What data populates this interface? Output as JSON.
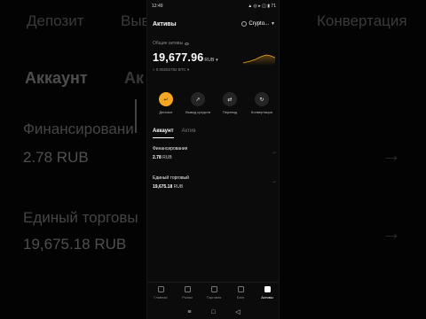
{
  "background": {
    "tabs": [
      "Депозит",
      "Выв",
      "Конвертация"
    ],
    "account_heading": "Аккаунт",
    "assets_heading_partial": "Ак",
    "financing_label": "Финансировани",
    "financing_value": "2.78 RUB",
    "unified_label": "Единый торговы",
    "unified_value": "19,675.18 RUB",
    "arrow": "→"
  },
  "status_bar": {
    "time": "12:49",
    "icons": "▲ ◎ ▸ ◫ ▮ 71"
  },
  "header": {
    "title": "Активы",
    "selector_label": "Crypto...",
    "selector_chevron": "▼"
  },
  "overview": {
    "label": "Общие активы",
    "total_value": "19,677.96",
    "total_currency": "RUB ▾",
    "btc_equiv": "≈ 0.00202792 BTC ▾"
  },
  "actions": [
    {
      "label": "Депозит",
      "icon": "↵"
    },
    {
      "label": "Вывод средств",
      "icon": "↗"
    },
    {
      "label": "Перевод",
      "icon": "⇄"
    },
    {
      "label": "Конвертация",
      "icon": "↻"
    }
  ],
  "tabs": {
    "account": "Аккаунт",
    "assets": "Актив"
  },
  "accounts": [
    {
      "name": "Финансирования",
      "amount": "2.78",
      "currency": "RUB",
      "go": "→"
    },
    {
      "name": "Единый торговый",
      "amount": "19,675.18",
      "currency": "RUB",
      "go": "→"
    }
  ],
  "bottom_nav": [
    {
      "label": "Главная"
    },
    {
      "label": "Рынки"
    },
    {
      "label": "Торговля"
    },
    {
      "label": "Earn"
    },
    {
      "label": "Активы"
    }
  ],
  "system_nav": [
    "≡",
    "□",
    "◁"
  ],
  "colors": {
    "accent": "#f5a623",
    "background": "#0b0b0b",
    "muted_text": "#888888"
  }
}
